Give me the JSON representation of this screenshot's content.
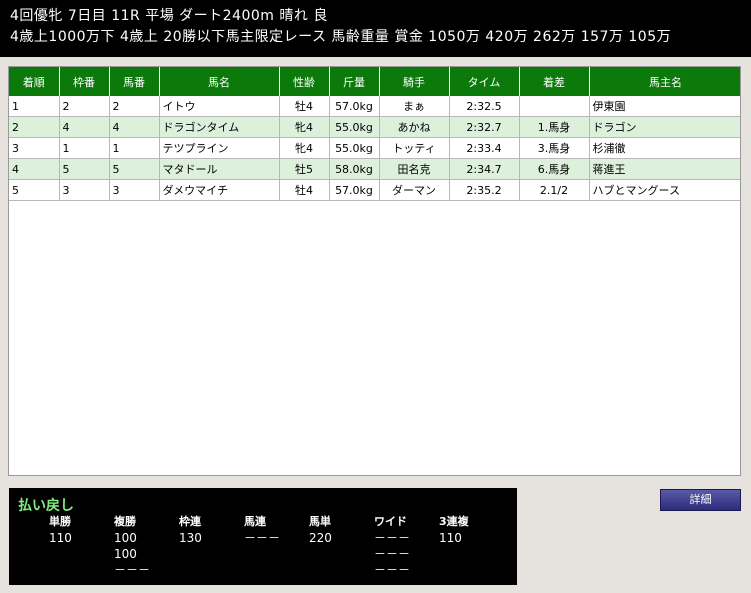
{
  "header": {
    "line1": "4回優牝  7日目  11R  平場  ダート2400m  晴れ  良",
    "line2": "4歳上1000万下  4歳上  20勝以下馬主限定レース  馬齢重量  賞金  1050万  420万  262万  157万  105万"
  },
  "results": {
    "columns": [
      "着順",
      "枠番",
      "馬番",
      "馬名",
      "性齢",
      "斤量",
      "騎手",
      "タイム",
      "着差",
      "馬主名"
    ],
    "rows": [
      [
        "1",
        "2",
        "2",
        "イトウ",
        "牡4",
        "57.0kg",
        "まぁ",
        "2:32.5",
        "",
        "伊東園"
      ],
      [
        "2",
        "4",
        "4",
        "ドラゴンタイム",
        "牝4",
        "55.0kg",
        "あかね",
        "2:32.7",
        "1.馬身",
        "ドラゴン"
      ],
      [
        "3",
        "1",
        "1",
        "テツプライン",
        "牝4",
        "55.0kg",
        "トッティ",
        "2:33.4",
        "3.馬身",
        "杉浦徹"
      ],
      [
        "4",
        "5",
        "5",
        "マタドール",
        "牡5",
        "58.0kg",
        "田名克",
        "2:34.7",
        "6.馬身",
        "蒋進王"
      ],
      [
        "5",
        "3",
        "3",
        "ダメウマイチ",
        "牡4",
        "57.0kg",
        "ダーマン",
        "2:35.2",
        "2.1/2",
        "ハブとマングース"
      ]
    ]
  },
  "payout": {
    "title": "払い戻し",
    "columns": [
      {
        "label": "単勝",
        "values": [
          "110"
        ]
      },
      {
        "label": "複勝",
        "values": [
          "100",
          "100",
          "－－－"
        ]
      },
      {
        "label": "枠連",
        "values": [
          "130"
        ]
      },
      {
        "label": "馬連",
        "values": [
          "－－－"
        ]
      },
      {
        "label": "馬単",
        "values": [
          "220"
        ]
      },
      {
        "label": "ワイド",
        "values": [
          "－－－",
          "－－－",
          "－－－"
        ]
      },
      {
        "label": "3連複",
        "values": [
          "110"
        ]
      }
    ]
  },
  "detail_button": "詳細"
}
